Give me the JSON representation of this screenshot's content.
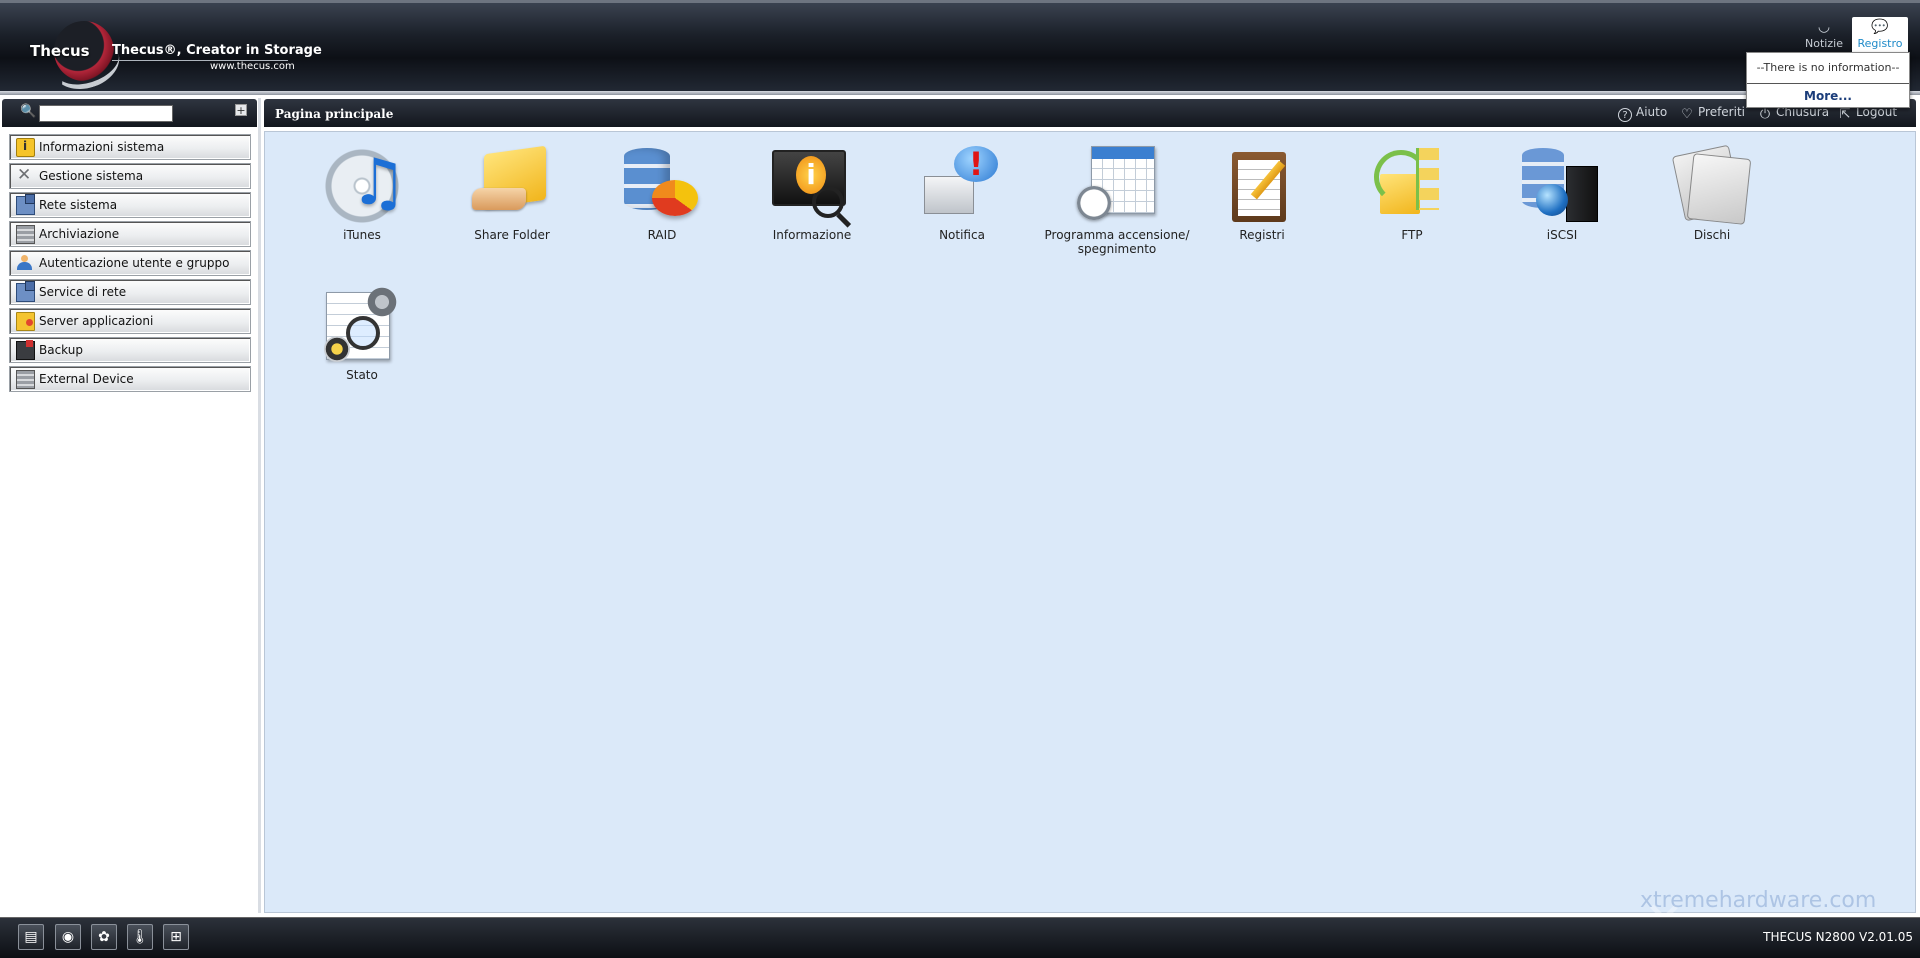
{
  "brand": {
    "name": "Thecus",
    "tagline": "Thecus®, Creator in Storage",
    "url": "www.thecus.com"
  },
  "header_tabs": [
    {
      "label": "Notizie",
      "icon": "rss-icon"
    },
    {
      "label": "Registro",
      "icon": "speech-bubble-icon",
      "active": true
    }
  ],
  "registro_popup": {
    "message": "--There is no information--",
    "more_label": "More..."
  },
  "sidebar": {
    "search_placeholder": "",
    "add_icon": "+",
    "items": [
      {
        "label": "Informazioni sistema",
        "icon": "info-icon"
      },
      {
        "label": "Gestione sistema",
        "icon": "tools-icon"
      },
      {
        "label": "Rete sistema",
        "icon": "network-icon"
      },
      {
        "label": "Archiviazione",
        "icon": "storage-icon"
      },
      {
        "label": "Autenticazione utente e gruppo",
        "icon": "users-icon"
      },
      {
        "label": "Service di rete",
        "icon": "network-service-icon"
      },
      {
        "label": "Server applicazioni",
        "icon": "app-folder-icon"
      },
      {
        "label": "Backup",
        "icon": "backup-icon"
      },
      {
        "label": "External Device",
        "icon": "external-device-icon"
      }
    ]
  },
  "main": {
    "title": "Pagina principale",
    "toolbar": {
      "aiuto": "Aiuto",
      "preferiti": "Preferiti",
      "chiusura": "Chiusura",
      "logout": "Logout"
    },
    "apps": [
      {
        "label": "iTunes",
        "icon": "itunes-icon"
      },
      {
        "label": "Share Folder",
        "icon": "share-folder-icon"
      },
      {
        "label": "RAID",
        "icon": "raid-icon"
      },
      {
        "label": "Informazione",
        "icon": "information-icon"
      },
      {
        "label": "Notifica",
        "icon": "notification-icon"
      },
      {
        "label": "Programma accensione/ spegnimento",
        "icon": "schedule-icon"
      },
      {
        "label": "Registri",
        "icon": "logs-icon"
      },
      {
        "label": "FTP",
        "icon": "ftp-icon"
      },
      {
        "label": "iSCSI",
        "icon": "iscsi-icon"
      },
      {
        "label": "Dischi",
        "icon": "disks-icon"
      },
      {
        "label": "Stato",
        "icon": "status-icon"
      }
    ]
  },
  "taskbar": {
    "buttons": [
      "storage-tray-icon",
      "disk-tray-icon",
      "fan-tray-icon",
      "temperature-tray-icon",
      "network-tray-icon"
    ],
    "version": "THECUS N2800 V2.01.05"
  },
  "watermark": "xtremehardware.com",
  "colors": {
    "desktop_bg": "#dbe9f9",
    "header_dark": "#12161d",
    "link_blue": "#1f8ac8"
  }
}
